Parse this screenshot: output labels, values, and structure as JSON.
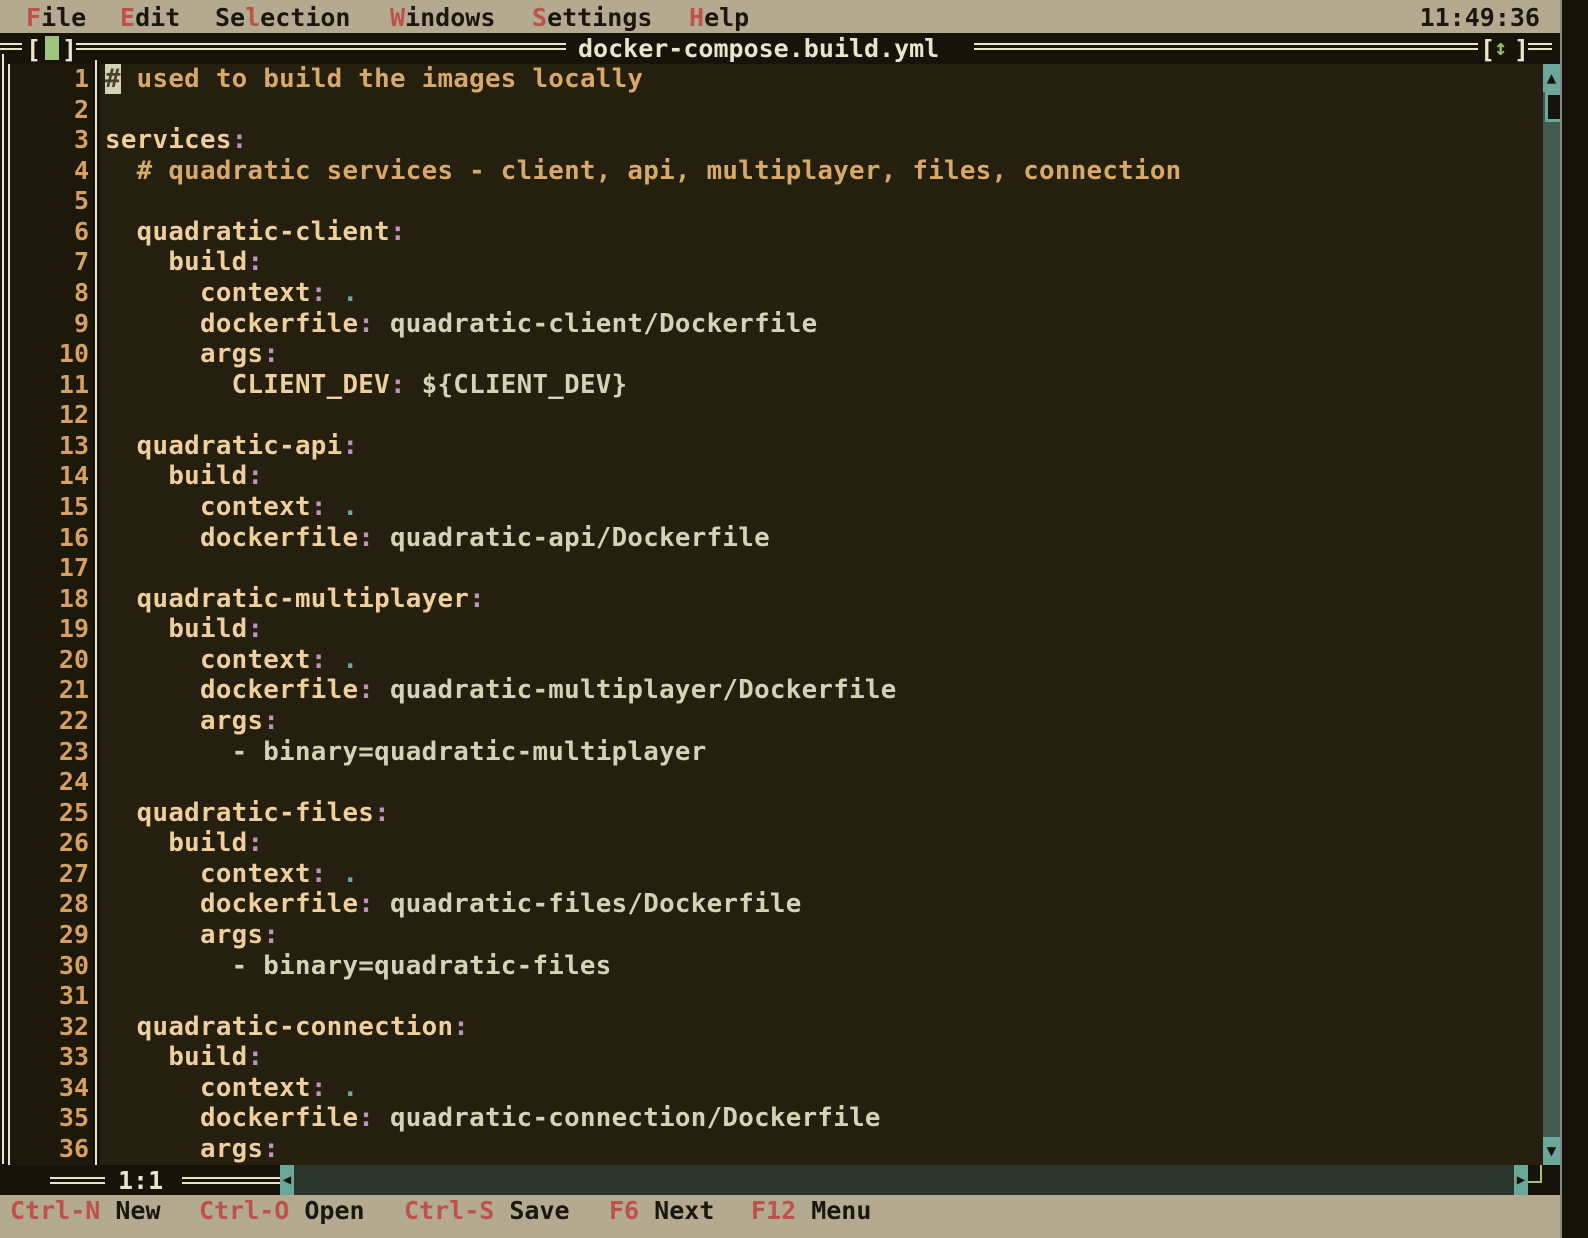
{
  "menubar": {
    "items": [
      {
        "hotkey": "F",
        "rest": "ile"
      },
      {
        "hotkey": "E",
        "rest": "dit"
      },
      {
        "pre": "Se",
        "hotkey": "l",
        "rest": "ection"
      },
      {
        "hotkey": "W",
        "rest": "indows"
      },
      {
        "hotkey": "S",
        "rest": "ettings"
      },
      {
        "hotkey": "H",
        "rest": "elp"
      }
    ],
    "clock": "11:49:36"
  },
  "window": {
    "title": "docker-compose.build.yml",
    "cursor_position": "1:1",
    "zoom_icon": "up-down-arrow"
  },
  "colors": {
    "background": "#251f10",
    "key": "#f0cf9c",
    "value": "#d8d2b4",
    "comment": "#d8a868",
    "punct": "#c090c0",
    "menubar": "#b4aa8f",
    "hotkey": "#c0504a"
  },
  "lines": [
    [
      [
        "cur",
        "#"
      ],
      [
        "c",
        " used to build the images locally"
      ]
    ],
    [],
    [
      [
        "k",
        "services"
      ],
      [
        "p",
        ":"
      ]
    ],
    [
      [
        "c",
        "  # quadratic services - client, api, multiplayer, files, connection"
      ]
    ],
    [],
    [
      [
        "k",
        "  quadratic-client"
      ],
      [
        "p",
        ":"
      ]
    ],
    [
      [
        "k",
        "    build"
      ],
      [
        "p",
        ":"
      ]
    ],
    [
      [
        "k",
        "      context"
      ],
      [
        "p",
        ": "
      ],
      [
        "d",
        "."
      ]
    ],
    [
      [
        "k",
        "      dockerfile"
      ],
      [
        "p",
        ": "
      ],
      [
        "v",
        "quadratic-client/Dockerfile"
      ]
    ],
    [
      [
        "k",
        "      args"
      ],
      [
        "p",
        ":"
      ]
    ],
    [
      [
        "k",
        "        CLIENT_DEV"
      ],
      [
        "p",
        ": "
      ],
      [
        "v",
        "${CLIENT_DEV}"
      ]
    ],
    [],
    [
      [
        "k",
        "  quadratic-api"
      ],
      [
        "p",
        ":"
      ]
    ],
    [
      [
        "k",
        "    build"
      ],
      [
        "p",
        ":"
      ]
    ],
    [
      [
        "k",
        "      context"
      ],
      [
        "p",
        ": "
      ],
      [
        "d",
        "."
      ]
    ],
    [
      [
        "k",
        "      dockerfile"
      ],
      [
        "p",
        ": "
      ],
      [
        "v",
        "quadratic-api/Dockerfile"
      ]
    ],
    [],
    [
      [
        "k",
        "  quadratic-multiplayer"
      ],
      [
        "p",
        ":"
      ]
    ],
    [
      [
        "k",
        "    build"
      ],
      [
        "p",
        ":"
      ]
    ],
    [
      [
        "k",
        "      context"
      ],
      [
        "p",
        ": "
      ],
      [
        "d",
        "."
      ]
    ],
    [
      [
        "k",
        "      dockerfile"
      ],
      [
        "p",
        ": "
      ],
      [
        "v",
        "quadratic-multiplayer/Dockerfile"
      ]
    ],
    [
      [
        "k",
        "      args"
      ],
      [
        "p",
        ":"
      ]
    ],
    [
      [
        "v",
        "        - binary=quadratic-multiplayer"
      ]
    ],
    [],
    [
      [
        "k",
        "  quadratic-files"
      ],
      [
        "p",
        ":"
      ]
    ],
    [
      [
        "k",
        "    build"
      ],
      [
        "p",
        ":"
      ]
    ],
    [
      [
        "k",
        "      context"
      ],
      [
        "p",
        ": "
      ],
      [
        "d",
        "."
      ]
    ],
    [
      [
        "k",
        "      dockerfile"
      ],
      [
        "p",
        ": "
      ],
      [
        "v",
        "quadratic-files/Dockerfile"
      ]
    ],
    [
      [
        "k",
        "      args"
      ],
      [
        "p",
        ":"
      ]
    ],
    [
      [
        "v",
        "        - binary=quadratic-files"
      ]
    ],
    [],
    [
      [
        "k",
        "  quadratic-connection"
      ],
      [
        "p",
        ":"
      ]
    ],
    [
      [
        "k",
        "    build"
      ],
      [
        "p",
        ":"
      ]
    ],
    [
      [
        "k",
        "      context"
      ],
      [
        "p",
        ": "
      ],
      [
        "d",
        "."
      ]
    ],
    [
      [
        "k",
        "      dockerfile"
      ],
      [
        "p",
        ": "
      ],
      [
        "v",
        "quadratic-connection/Dockerfile"
      ]
    ],
    [
      [
        "k",
        "      args"
      ],
      [
        "p",
        ":"
      ]
    ]
  ],
  "statusbar": [
    {
      "key": "Ctrl-N",
      "label": "New"
    },
    {
      "key": "Ctrl-O",
      "label": "Open"
    },
    {
      "key": "Ctrl-S",
      "label": "Save"
    },
    {
      "key": "F6",
      "label": "Next"
    },
    {
      "key": "F12",
      "label": "Menu"
    }
  ]
}
